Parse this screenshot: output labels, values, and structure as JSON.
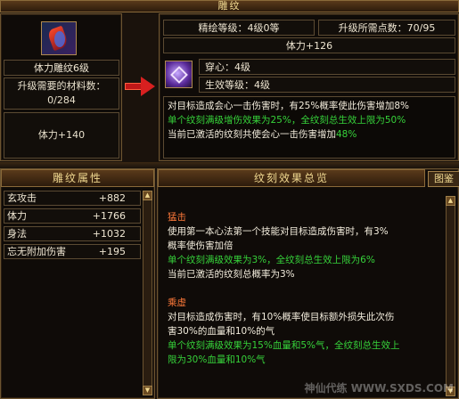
{
  "header": {
    "title": "雕纹"
  },
  "left_card": {
    "icon": "carving-icon",
    "item_name": "体力雕纹6级",
    "upgrade_label": "升级需要的材料数：",
    "material_count": "0/284",
    "stat": "体力+140"
  },
  "right_card": {
    "refine_level": "精绘等级：4级0等",
    "upgrade_points": "升级所需点数：70/95",
    "stat": "体力+126",
    "gem_icon": "gem-icon",
    "pierce": "穿心：4级",
    "active_level": "生效等级：4级",
    "desc_line1": "对目标造成会心一击伤害时，有25%概率使此伤害增加8%",
    "desc_line2": "单个纹刻满级增伤效果为25%，全纹刻总生效上限为50%",
    "desc_line3_prefix": "当前已激活的纹刻共使会心一击伤害增加",
    "desc_line3_value": "48%"
  },
  "attributes": {
    "title": "雕纹属性",
    "rows": [
      {
        "key": "玄攻击",
        "value": "+882"
      },
      {
        "key": "体力",
        "value": "+1766"
      },
      {
        "key": "身法",
        "value": "+1032"
      },
      {
        "key": "忘无附加伤害",
        "value": "+195"
      }
    ]
  },
  "effects": {
    "title": "纹刻效果总览",
    "tab": "图鉴",
    "items": [
      {
        "name": "猛击",
        "desc1": "使用第一本心法第一个技能对目标造成伤害时，有3%",
        "desc2": "概率使伤害加倍",
        "green1": "单个纹刻满级效果为3%，全纹刻总生效上限为6%",
        "active": "当前已激活的纹刻总概率为3%"
      },
      {
        "name": "乘虚",
        "desc1": "对目标造成伤害时，有10%概率使目标额外损失此次伤",
        "desc2": "害30%的血量和10%的气",
        "green1": "单个纹刻满级效果为15%血量和5%气，全纹刻总生效上",
        "green2": "限为30%血量和10%气"
      }
    ]
  },
  "colors": {
    "green": "#36d23a",
    "orange": "#ff7a3a",
    "gold": "#f0d890"
  },
  "watermark": "神仙代练 WWW.SXDS.COM"
}
